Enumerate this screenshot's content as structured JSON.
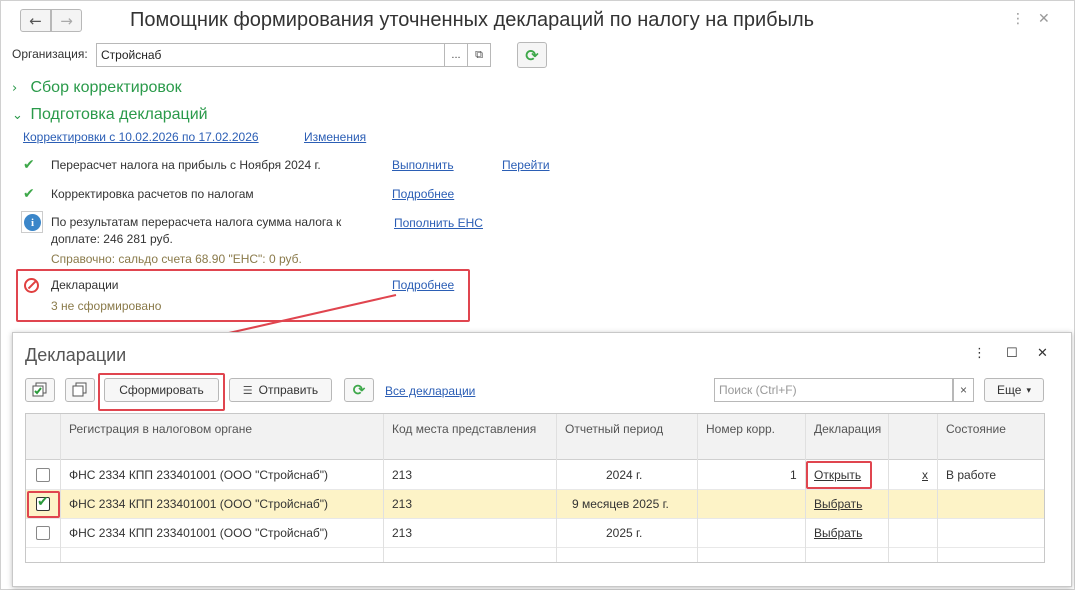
{
  "window": {
    "title": "Помощник формирования уточненных деклараций по налогу на прибыль",
    "back_icon": "←",
    "forward_icon": "→",
    "more_icon": "⋮",
    "close_icon": "✕"
  },
  "organization": {
    "label": "Организация:",
    "value": "Стройснаб",
    "select_icon": "...",
    "open_icon": "⧉",
    "refresh_icon": "⟳"
  },
  "sections": {
    "collect": {
      "label": "Сбор корректировок",
      "chevron": "›"
    },
    "prepare": {
      "label": "Подготовка деклараций",
      "chevron": "⌄"
    }
  },
  "corrections": {
    "period_link": "Корректировки с 10.02.2026 по 17.02.2026",
    "changes_link": "Изменения"
  },
  "tasks": [
    {
      "text": "Перерасчет налога на прибыль с Ноября 2024 г.",
      "action1": "Выполнить",
      "action2": "Перейти"
    },
    {
      "text": "Корректировка расчетов по налогам",
      "action1": "Подробнее"
    }
  ],
  "info": {
    "icon": "i",
    "line1": "По результатам перерасчета налога сумма налога к",
    "line2": "доплате: 246 281 руб.",
    "action": "Пополнить ЕНС",
    "note": "Справочно: сальдо счета 68.90 \"ЕНС\": 0 руб."
  },
  "declarations_status": {
    "title": "Декларации",
    "subtitle": "3 не сформировано",
    "action": "Подробнее"
  },
  "dialog": {
    "title": "Декларации",
    "more_icon": "⋮",
    "maximize_icon": "☐",
    "close_icon": "✕",
    "toolbar": {
      "form_button": "Сформировать",
      "send_button": "Отправить",
      "refresh_icon": "⟳",
      "all_link": "Все декларации",
      "search_placeholder": "Поиск (Ctrl+F)",
      "search_clear": "×",
      "more_button": "Еще",
      "more_arrow": "▾"
    },
    "columns": [
      "Регистрация в налоговом органе",
      "Код места представления",
      "Отчетный период",
      "Номер корр.",
      "Декларация",
      "Состояние"
    ],
    "rows": [
      {
        "checked": false,
        "reg": "ФНС 2334 КПП 233401001 (ООО \"Стройснаб\")",
        "code": "213",
        "period": "2024 г.",
        "corr": "1",
        "decl": "Открыть",
        "del": "x",
        "state": "В работе"
      },
      {
        "checked": true,
        "reg": "ФНС 2334 КПП 233401001 (ООО \"Стройснаб\")",
        "code": "213",
        "period": "9 месяцев 2025 г.",
        "corr": "",
        "decl": "Выбрать",
        "del": "",
        "state": ""
      },
      {
        "checked": false,
        "reg": "ФНС 2334 КПП 233401001 (ООО \"Стройснаб\")",
        "code": "213",
        "period": "2025 г.",
        "corr": "",
        "decl": "Выбрать",
        "del": "",
        "state": ""
      }
    ]
  },
  "colors": {
    "section_green": "#2a9a4a",
    "link_blue": "#2b5eb5",
    "highlight_red": "#e0454f",
    "selected_row": "#fdf3c7"
  }
}
